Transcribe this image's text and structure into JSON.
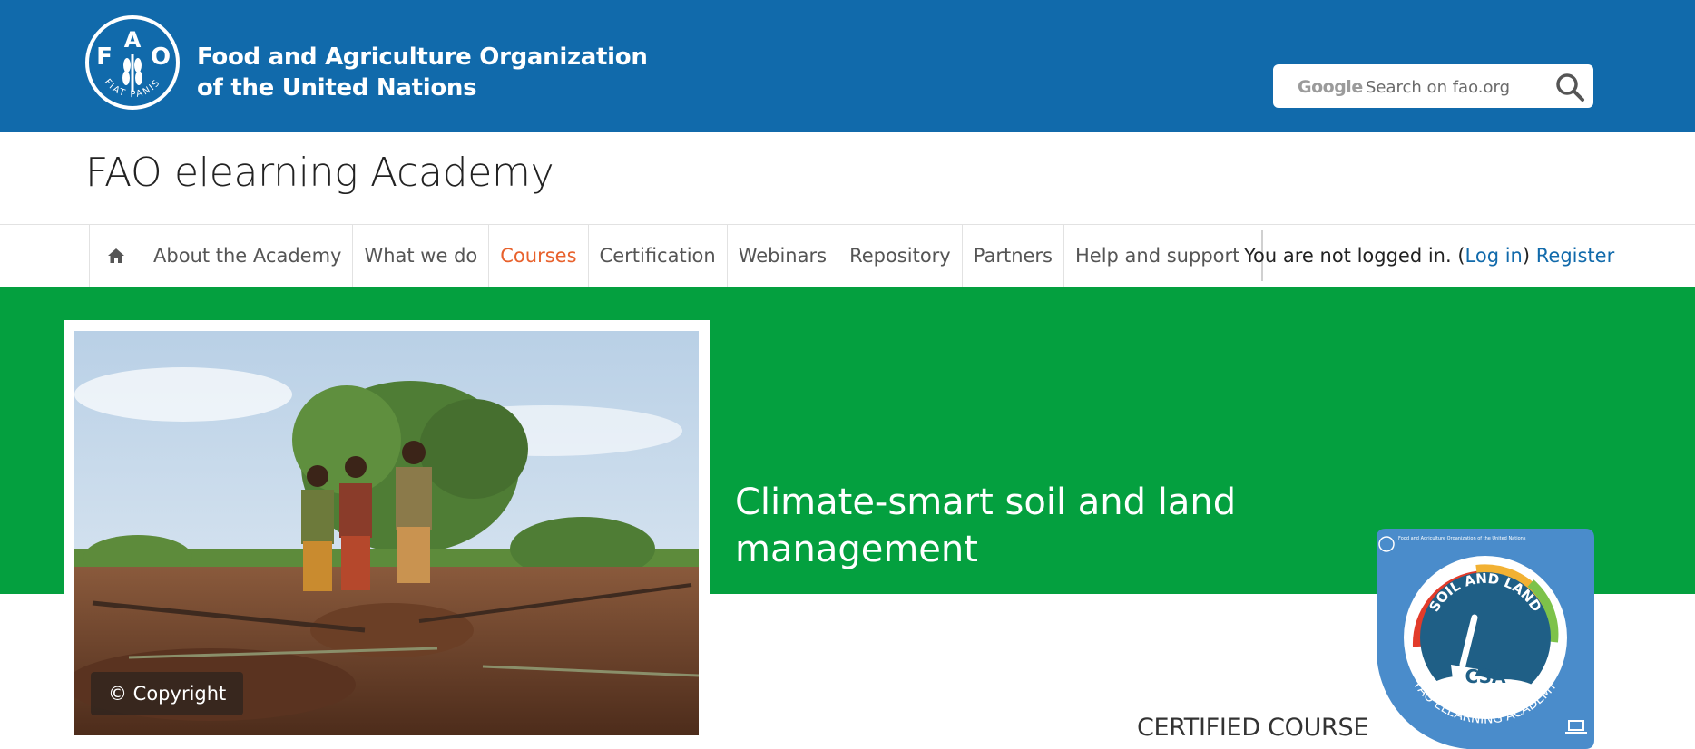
{
  "header": {
    "org_name_line1": "Food and Agriculture Organization",
    "org_name_line2": "of the United Nations",
    "logo_letters": [
      "F",
      "A",
      "O"
    ],
    "logo_motto": "FIAT PANIS",
    "search": {
      "brand": "Google",
      "placeholder": "Search on fao.org",
      "icon": "search-icon"
    }
  },
  "site_title": "FAO elearning Academy",
  "nav": {
    "home_icon": "home-icon",
    "items": [
      {
        "label": "About the Academy"
      },
      {
        "label": "What we do"
      },
      {
        "label": "Courses",
        "active": true
      },
      {
        "label": "Certification"
      },
      {
        "label": "Webinars"
      },
      {
        "label": "Repository"
      },
      {
        "label": "Partners"
      },
      {
        "label": "Help and support"
      }
    ]
  },
  "login": {
    "text": "You are not logged in. (",
    "login_label": "Log in",
    "close_paren": ")",
    "register_label": "Register"
  },
  "hero": {
    "copyright": "© Copyright",
    "course_title": "Climate-smart soil and land management",
    "certified_label": "CERTIFIED COURSE",
    "badge": {
      "org": "Food and Agriculture Organization of the United Nations",
      "arc_text": "SOIL AND LAND",
      "code": "CSA",
      "footer_text": "FAO ELEARNING ACADEMY"
    }
  },
  "colors": {
    "header_blue": "#116aab",
    "hero_green": "#04a03f",
    "active_nav": "#e8612c",
    "link_blue": "#116aab"
  }
}
